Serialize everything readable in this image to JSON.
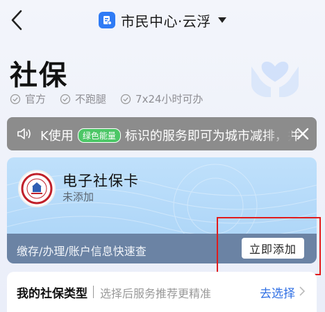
{
  "header": {
    "title": "市民中心·云浮",
    "app_icon": "document-icon",
    "back_icon": "chevron-left-icon",
    "dropdown_icon": "caret-down-icon"
  },
  "hero": {
    "title": "社保",
    "badges": [
      "官方",
      "不跑腿",
      "7x24小时可办"
    ],
    "art_icon": "heart-hands-icon"
  },
  "notice": {
    "text_before": "K使用",
    "pill": "绿色能量",
    "text_after": "标识的服务即可为城市减排，并",
    "speaker_icon": "speaker-icon",
    "close_icon": "close-icon"
  },
  "card": {
    "name": "电子社保卡",
    "status": "未添加",
    "description": "缴存/办理/账户信息快速查",
    "action_label": "立即添加",
    "logo_icon": "social-security-seal-icon"
  },
  "type_row": {
    "label": "我的社保类型",
    "hint": "选择后服务推荐更精准",
    "action_label": "去选择",
    "chevron_icon": "chevron-right-icon"
  },
  "colors": {
    "accent": "#2f7bf5",
    "link": "#2f6fe4",
    "green_pill": "#4cc766",
    "highlight": "#e11b1b"
  }
}
